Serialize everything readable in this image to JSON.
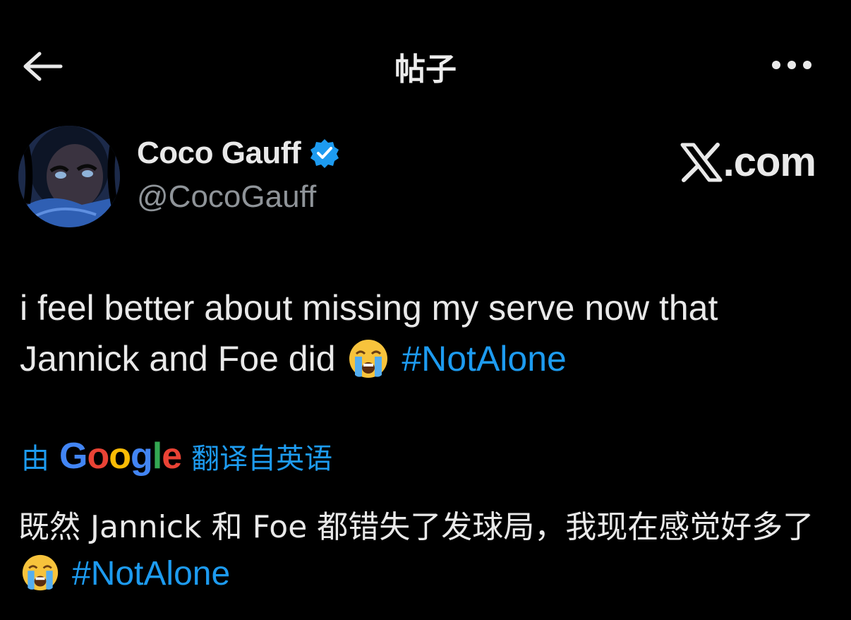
{
  "header": {
    "title": "帖子",
    "back_icon": "back-arrow-icon",
    "more_icon": "more-horizontal-icon"
  },
  "author": {
    "display_name": "Coco Gauff",
    "handle": "@CocoGauff",
    "verified": true,
    "badge_color": "#1d9bf0"
  },
  "watermark": {
    "suffix": ".com"
  },
  "tweet": {
    "text_line1": "i feel better about missing my serve now that",
    "text_line2": "Jannick and Foe did",
    "emoji": "loudly-crying-face",
    "hashtag": "#NotAlone"
  },
  "translation": {
    "prefix": "由",
    "provider": "Google",
    "suffix": "翻译自英语",
    "text": "既然 Jannick 和 Foe 都错失了发球局，我现在感觉好多了",
    "emoji": "loudly-crying-face",
    "hashtag": "#NotAlone"
  },
  "colors": {
    "background": "#000000",
    "text_primary": "#e9e9e9",
    "text_secondary": "#8f9499",
    "accent": "#1d9bf0"
  }
}
